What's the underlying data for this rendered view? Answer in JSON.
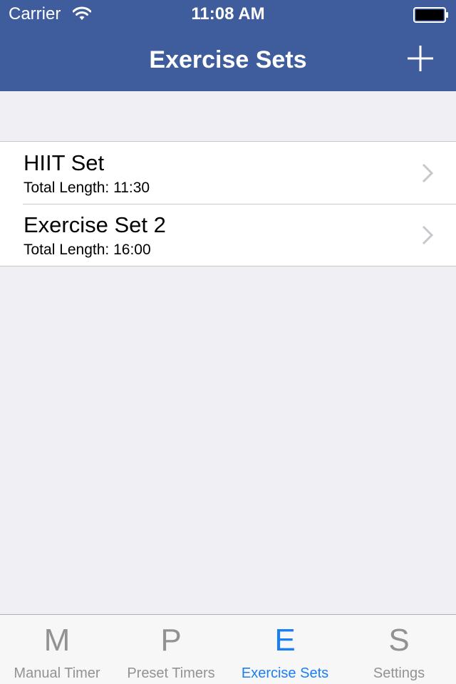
{
  "status_bar": {
    "carrier": "Carrier",
    "time": "11:08 AM",
    "icons": [
      "wifi-icon",
      "battery-icon"
    ]
  },
  "nav_bar": {
    "title": "Exercise Sets",
    "add_icon": "plus-icon"
  },
  "exercise_sets": [
    {
      "title": "HIIT Set",
      "subtitle": "Total Length: 11:30"
    },
    {
      "title": "Exercise Set 2",
      "subtitle": "Total Length: 16:00"
    }
  ],
  "tab_bar": {
    "tabs": [
      {
        "glyph": "M",
        "label": "Manual Timer",
        "active": false
      },
      {
        "glyph": "P",
        "label": "Preset Timers",
        "active": false
      },
      {
        "glyph": "E",
        "label": "Exercise Sets",
        "active": true
      },
      {
        "glyph": "S",
        "label": "Settings",
        "active": false
      }
    ]
  },
  "colors": {
    "nav_background": "#3f5d9c",
    "page_background": "#efeff4",
    "active_tab": "#1a7ff5",
    "inactive_tab": "#929292",
    "chevron": "#c7c7cc"
  }
}
